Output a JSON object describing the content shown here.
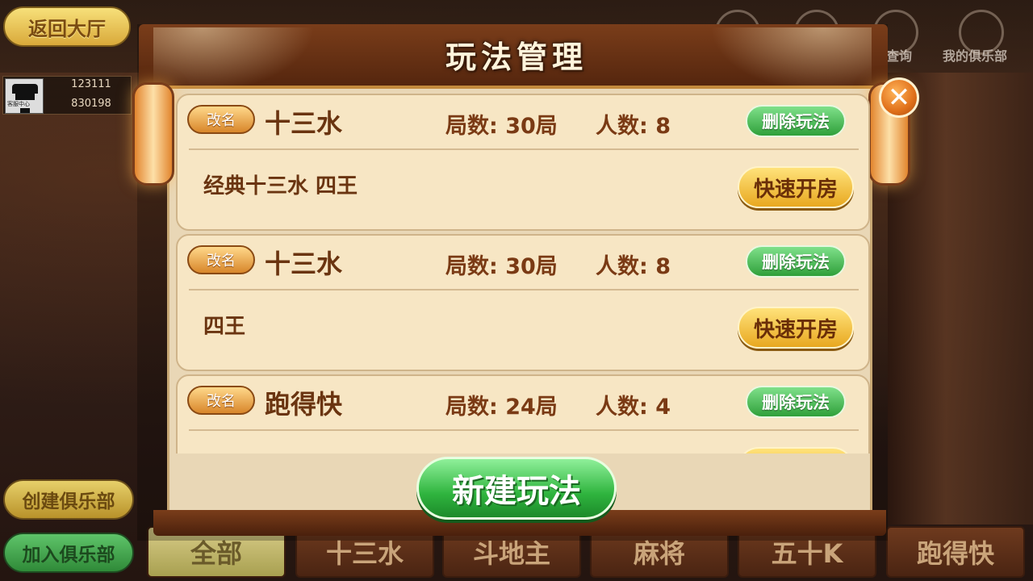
{
  "top_left": {
    "back_label": "返回大厅",
    "user_line1": "123111",
    "user_line2": "830198",
    "avatar_text": "客服中心"
  },
  "top_right": {
    "query_label": "查询",
    "my_club_label": "我的俱乐部",
    "icons": [
      "person-icon",
      "friends-icon",
      "search-icon",
      "home-icon"
    ]
  },
  "side_buttons": {
    "create_label": "创建俱乐部",
    "join_label": "加入俱乐部"
  },
  "tabs": [
    {
      "label": "全部",
      "active": true
    },
    {
      "label": "十三水",
      "active": false
    },
    {
      "label": "斗地主",
      "active": false
    },
    {
      "label": "麻将",
      "active": false
    },
    {
      "label": "五十K",
      "active": false
    },
    {
      "label": "跑得快",
      "active": false
    }
  ],
  "modal": {
    "title": "玩法管理",
    "close_glyph": "✕",
    "new_rule_label": "新建玩法",
    "rename_label": "改名",
    "delete_label": "删除玩法",
    "quick_room_label": "快速开房",
    "rules": [
      {
        "name": "十三水",
        "rounds": "局数: 30局",
        "players": "人数: 8",
        "desc": "经典十三水 四王"
      },
      {
        "name": "十三水",
        "rounds": "局数: 30局",
        "players": "人数: 8",
        "desc": "四王"
      },
      {
        "name": "跑得快",
        "rounds": "局数: 24局",
        "players": "人数: 4",
        "desc": ""
      }
    ]
  },
  "colors": {
    "accent_gold": "#e8a820",
    "accent_green": "#2fb43e",
    "card_bg": "#f7e6c4",
    "text_brown": "#6a3410"
  }
}
